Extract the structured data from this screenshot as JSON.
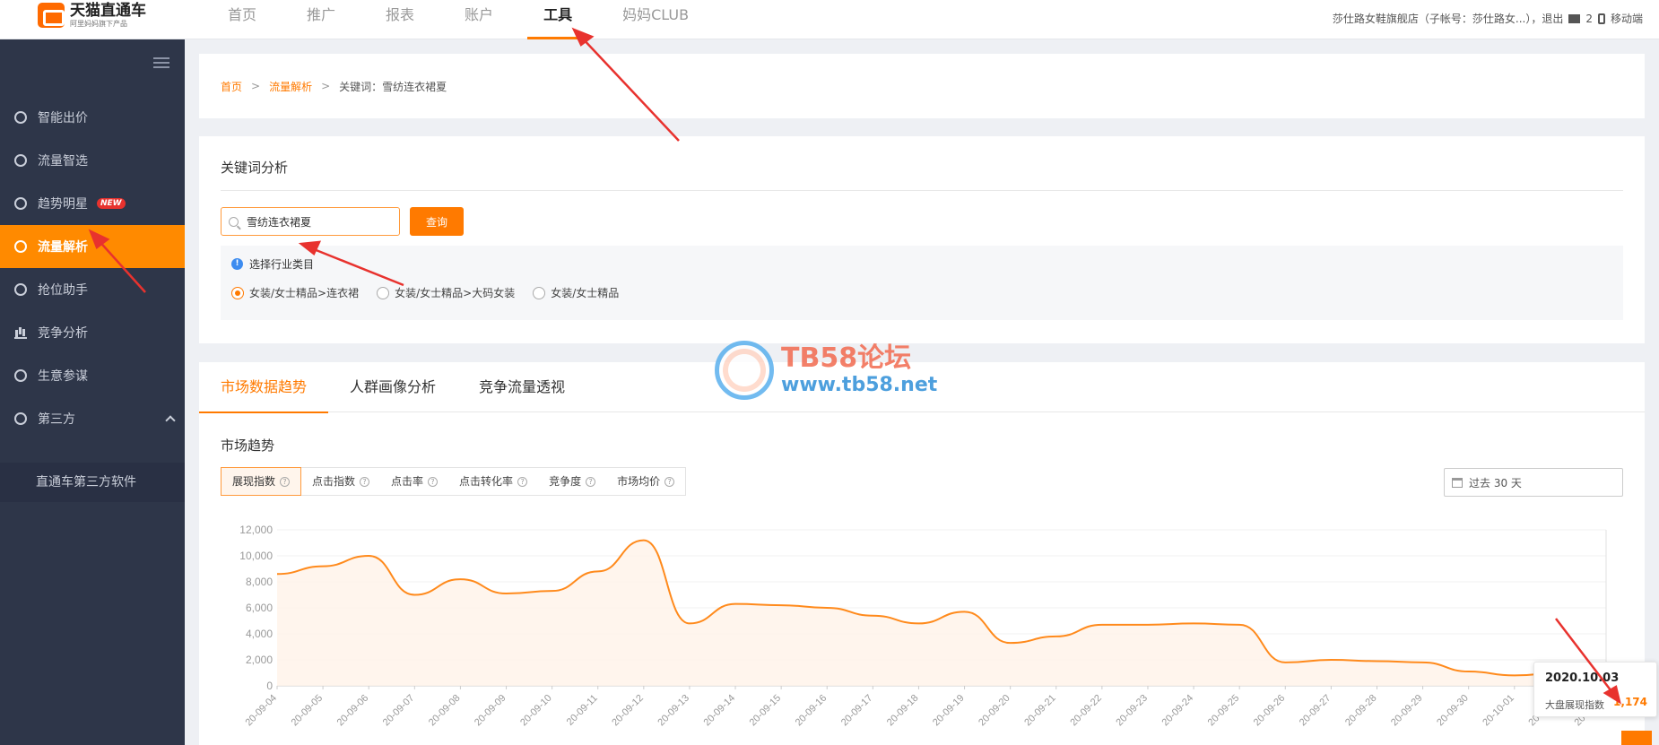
{
  "brand": {
    "title": "天猫直通车",
    "subtitle": "阿里妈妈旗下产品"
  },
  "nav": {
    "items": [
      {
        "label": "首页",
        "active": false
      },
      {
        "label": "推广",
        "active": false
      },
      {
        "label": "报表",
        "active": false
      },
      {
        "label": "账户",
        "active": false
      },
      {
        "label": "工具",
        "active": true
      },
      {
        "label": "妈妈CLUB",
        "active": false
      }
    ]
  },
  "topright": {
    "account": "莎仕路女鞋旗舰店（子帐号：莎仕路女...），退出",
    "mail_count": "2",
    "mobile": "移动端"
  },
  "sidebar": {
    "items": [
      {
        "label": "智能出价"
      },
      {
        "label": "流量智选"
      },
      {
        "label": "趋势明星",
        "badge": "NEW"
      },
      {
        "label": "流量解析",
        "active": true
      },
      {
        "label": "抢位助手"
      },
      {
        "label": "竞争分析"
      },
      {
        "label": "生意参谋"
      },
      {
        "label": "第三方"
      }
    ],
    "sub_item": "直通车第三方软件"
  },
  "breadcrumb": {
    "home": "首页",
    "section": "流量解析",
    "sep": ">",
    "current": "关键词：雪纺连衣裙夏"
  },
  "keyword": {
    "title": "关键词分析",
    "search_value": "雪纺连衣裙夏",
    "query_button": "查询",
    "category_title": "选择行业类目",
    "categories": [
      {
        "label": "女装/女士精品>连衣裙",
        "selected": true
      },
      {
        "label": "女装/女士精品>大码女装",
        "selected": false
      },
      {
        "label": "女装/女士精品",
        "selected": false
      }
    ]
  },
  "trend": {
    "tabs": [
      "市场数据趋势",
      "人群画像分析",
      "竞争流量透视"
    ],
    "section_title": "市场趋势",
    "metrics": [
      "展现指数",
      "点击指数",
      "点击率",
      "点击转化率",
      "竞争度",
      "市场均价"
    ],
    "date_range": "过去 30 天"
  },
  "watermark": {
    "line1": "TB58论坛",
    "line2": "www.tb58.net"
  },
  "tooltip": {
    "date": "2020.10.03",
    "label": "大盘展现指数",
    "value": "1,174"
  },
  "colors": {
    "accent": "#ff7a00",
    "sidebar": "#2e3649",
    "arrow": "#e8322e"
  },
  "chart_data": {
    "type": "area",
    "title": "",
    "xlabel": "",
    "ylabel": "",
    "ylim": [
      0,
      12000
    ],
    "yticks": [
      0,
      2000,
      4000,
      6000,
      8000,
      10000,
      12000
    ],
    "ytick_labels": [
      "0",
      "2,000",
      "4,000",
      "6,000",
      "8,000",
      "10,000",
      "12,000"
    ],
    "x": [
      "20-09-04",
      "20-09-05",
      "20-09-06",
      "20-09-07",
      "20-09-08",
      "20-09-09",
      "20-09-10",
      "20-09-11",
      "20-09-12",
      "20-09-13",
      "20-09-14",
      "20-09-15",
      "20-09-16",
      "20-09-17",
      "20-09-18",
      "20-09-19",
      "20-09-20",
      "20-09-21",
      "20-09-22",
      "20-09-23",
      "20-09-24",
      "20-09-25",
      "20-09-26",
      "20-09-27",
      "20-09-28",
      "20-09-29",
      "20-09-30",
      "20-10-01",
      "20-10-02",
      "20-10-03"
    ],
    "series": [
      {
        "values": [
          8600,
          9200,
          10000,
          7000,
          8200,
          7100,
          7300,
          8800,
          11200,
          4800,
          6300,
          6200,
          6000,
          5400,
          4800,
          5700,
          3300,
          3800,
          4700,
          4700,
          4800,
          4700,
          1800,
          2000,
          1900,
          1800,
          1100,
          800,
          1000,
          1174
        ]
      }
    ],
    "color": "#ff8a1c",
    "grid": true
  }
}
